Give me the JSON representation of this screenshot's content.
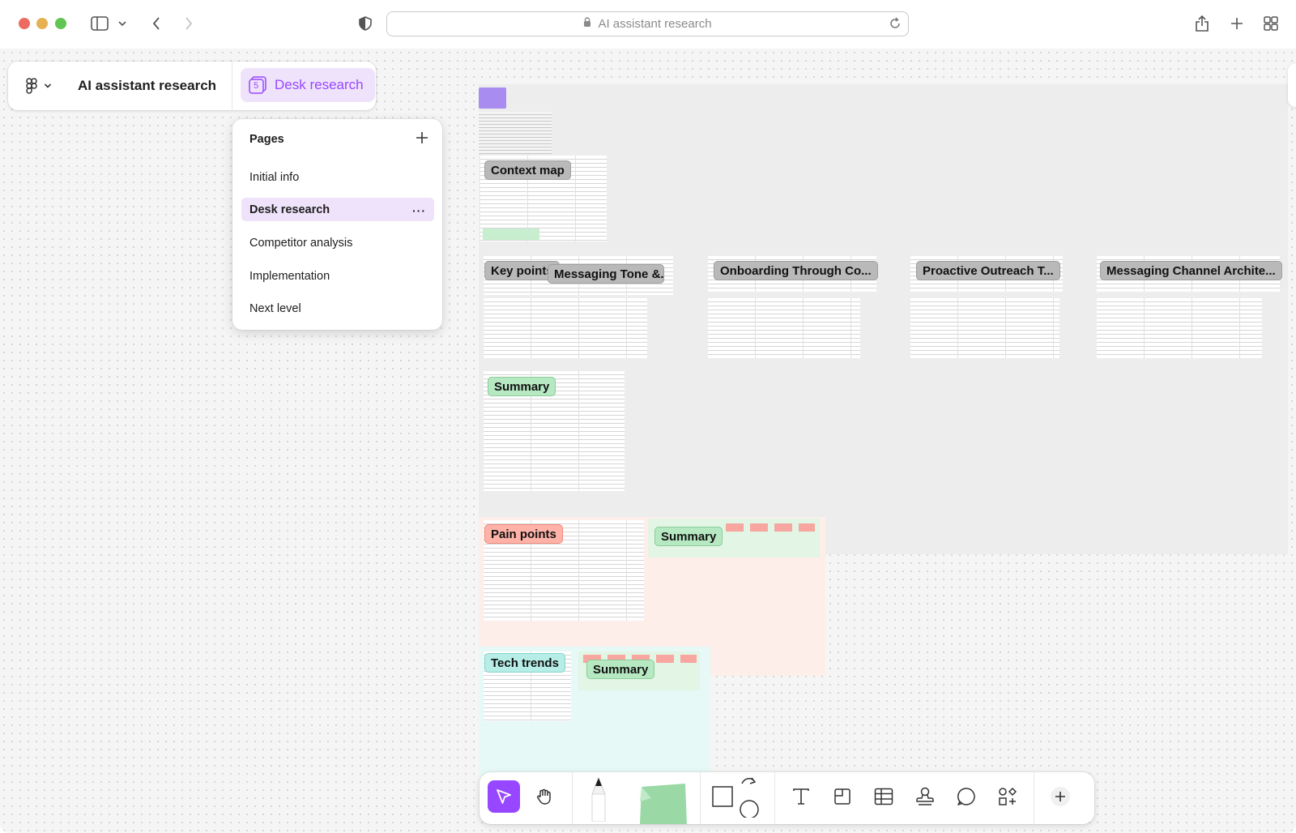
{
  "browser": {
    "url_text": "AI assistant research"
  },
  "filebar": {
    "file_name": "AI assistant research",
    "page_name": "Desk research",
    "page_number": "5"
  },
  "pages_menu": {
    "title": "Pages",
    "items": [
      {
        "label": "Initial info",
        "active": false
      },
      {
        "label": "Desk research",
        "active": true
      },
      {
        "label": "Competitor analysis",
        "active": false
      },
      {
        "label": "Implementation",
        "active": false
      },
      {
        "label": "Next level",
        "active": false
      }
    ],
    "more_label": "···"
  },
  "board": {
    "labels": {
      "context_map": "Context map",
      "key_points": "Key points",
      "messaging_tone": "Messaging Tone &...",
      "onboarding": "Onboarding Through Co...",
      "proactive": "Proactive Outreach T...",
      "channel": "Messaging Channel Archite...",
      "summary_1": "Summary",
      "pain_points": "Pain points",
      "summary_2": "Summary",
      "tech_trends": "Tech trends",
      "summary_3": "Summary"
    },
    "colors": {
      "gray_label": "#b9b9b9",
      "green_label": "#b6e8c2",
      "red_label": "#ffb2a8",
      "teal_label": "#b6ede6",
      "pain_bg": "#fdeeea",
      "tech_bg": "#e6f9f6",
      "summary_bg": "#e3f5e5"
    }
  },
  "toolbar": {
    "tools": [
      "move-icon",
      "hand-icon",
      "marker-icon",
      "sticky-note-icon",
      "shape-icon",
      "text-icon",
      "section-icon",
      "table-icon",
      "stamp-icon",
      "comment-icon",
      "widgets-icon",
      "add-icon"
    ],
    "accent": "#9747ff"
  }
}
